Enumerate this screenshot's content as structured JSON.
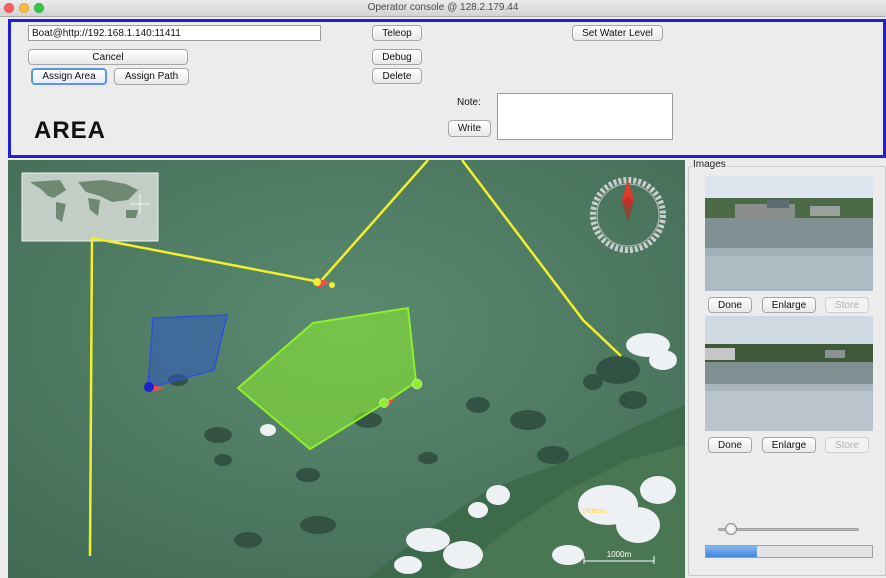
{
  "window": {
    "title": "Operator console @ 128.2.179.44"
  },
  "controls": {
    "boat_address": "Boat@http://192.168.1.140:11411",
    "cancel_label": "Cancel",
    "assign_area_label": "Assign Area",
    "assign_path_label": "Assign Path",
    "teleop_label": "Teleop",
    "debug_label": "Debug",
    "delete_label": "Delete",
    "set_water_level_label": "Set Water Level",
    "mode_text": "AREA",
    "note_label": "Note:",
    "note_value": "",
    "write_label": "Write"
  },
  "map": {
    "scale_label": "1000m",
    "place_label": "Victoria",
    "colors": {
      "path": "#f2ef2c",
      "area_blue": "#2b52d6",
      "area_green": "#8ef02c"
    }
  },
  "images_panel": {
    "title": "Images",
    "items": [
      {
        "done_label": "Done",
        "enlarge_label": "Enlarge",
        "store_label": "Store"
      },
      {
        "done_label": "Done",
        "enlarge_label": "Enlarge",
        "store_label": "Store"
      }
    ],
    "slider_value": 0.05,
    "progress_value": 0.31
  }
}
